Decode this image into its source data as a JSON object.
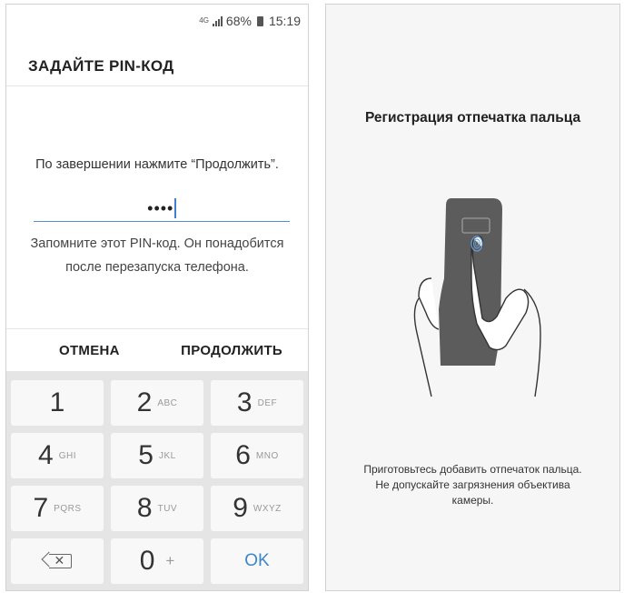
{
  "status_bar": {
    "network": "4G",
    "battery": "68%",
    "time": "15:19"
  },
  "pin_screen": {
    "title": "ЗАДАЙТЕ PIN-КОД",
    "instruction": "По завершении нажмите “Продолжить”.",
    "pin_value": "••••",
    "hint_line1": "Запомните этот PIN-код. Он понадобится",
    "hint_line2": "после перезапуска телефона.",
    "cancel_label": "ОТМЕНА",
    "continue_label": "ПРОДОЛЖИТЬ"
  },
  "keypad": {
    "keys": [
      {
        "digit": "1",
        "letters": ""
      },
      {
        "digit": "2",
        "letters": "ABC"
      },
      {
        "digit": "3",
        "letters": "DEF"
      },
      {
        "digit": "4",
        "letters": "GHI"
      },
      {
        "digit": "5",
        "letters": "JKL"
      },
      {
        "digit": "6",
        "letters": "MNO"
      },
      {
        "digit": "7",
        "letters": "PQRS"
      },
      {
        "digit": "8",
        "letters": "TUV"
      },
      {
        "digit": "9",
        "letters": "WXYZ"
      }
    ],
    "zero": "0",
    "plus": "+",
    "ok_label": "OK",
    "backspace_symbol": "✕"
  },
  "fingerprint_screen": {
    "title": "Регистрация отпечатка пальца",
    "hint_line1": "Приготовьтесь добавить отпечаток пальца.",
    "hint_line2": "Не допускайте загрязнения объектива",
    "hint_line3": "камеры."
  },
  "icons": {
    "signal": "signal-bars-icon",
    "battery": "battery-icon",
    "backspace": "backspace-icon",
    "illustration": "hand-holding-phone-fingerprint-icon"
  },
  "colors": {
    "accent": "#3d86c9",
    "keypad_bg": "#e5e5e5",
    "key_bg": "#f8f8f8"
  }
}
